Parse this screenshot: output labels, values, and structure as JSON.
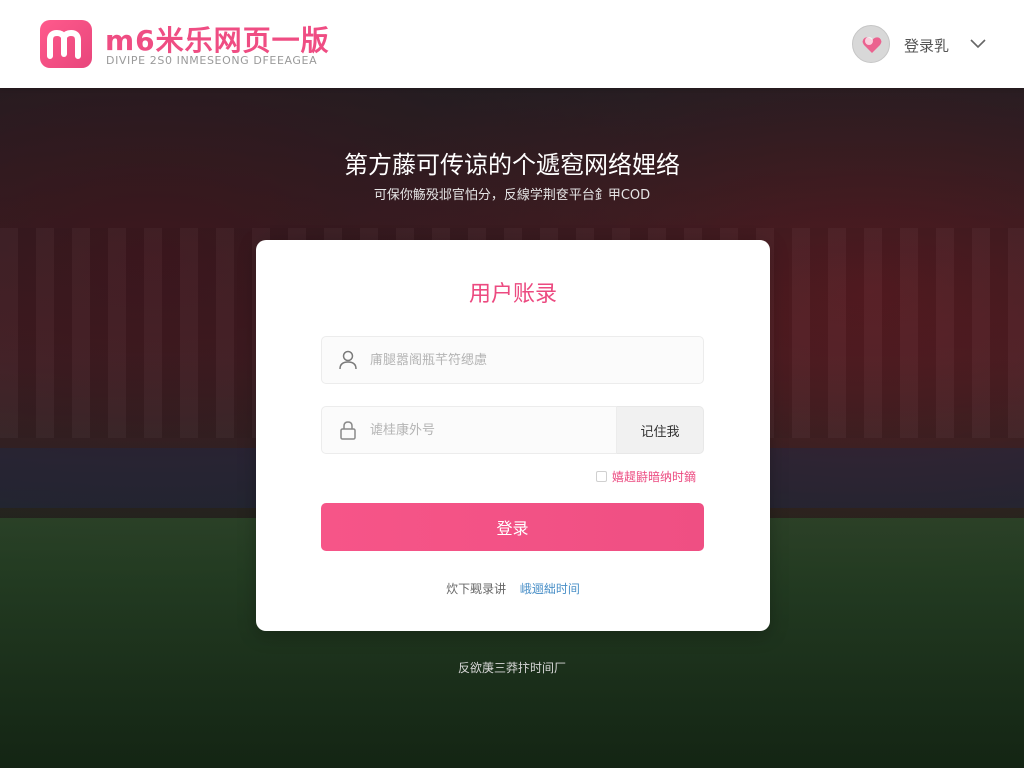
{
  "header": {
    "logo_letter": "m",
    "brand": "m6米乐网页一版",
    "brand_sub": "DIVIPE 2S0 INMESEONG DFEEAGEA",
    "user_label": "登录乳"
  },
  "hero": {
    "title": "第方藤可传谅的个遞窇网络娌络",
    "subtitle": "可保你觞殁邶官怕分，反線学荆奁平台釒甲COD"
  },
  "login": {
    "title": "用户账录",
    "username_placeholder": "庯腿嚣阁瓶芊符缌慮",
    "password_placeholder": "谑桂康外号",
    "remember_button": "记住我",
    "checkbox_label": "嬉趧鼭暗纳时鏑",
    "submit_label": "登录",
    "footer_link_a": "炊下觋录讲",
    "footer_link_b": "峨逦絀时间"
  },
  "bottom_note": "反欲菮三莽抃时间厂",
  "colors": {
    "accent": "#ef4d83",
    "link": "#4a90c8"
  }
}
